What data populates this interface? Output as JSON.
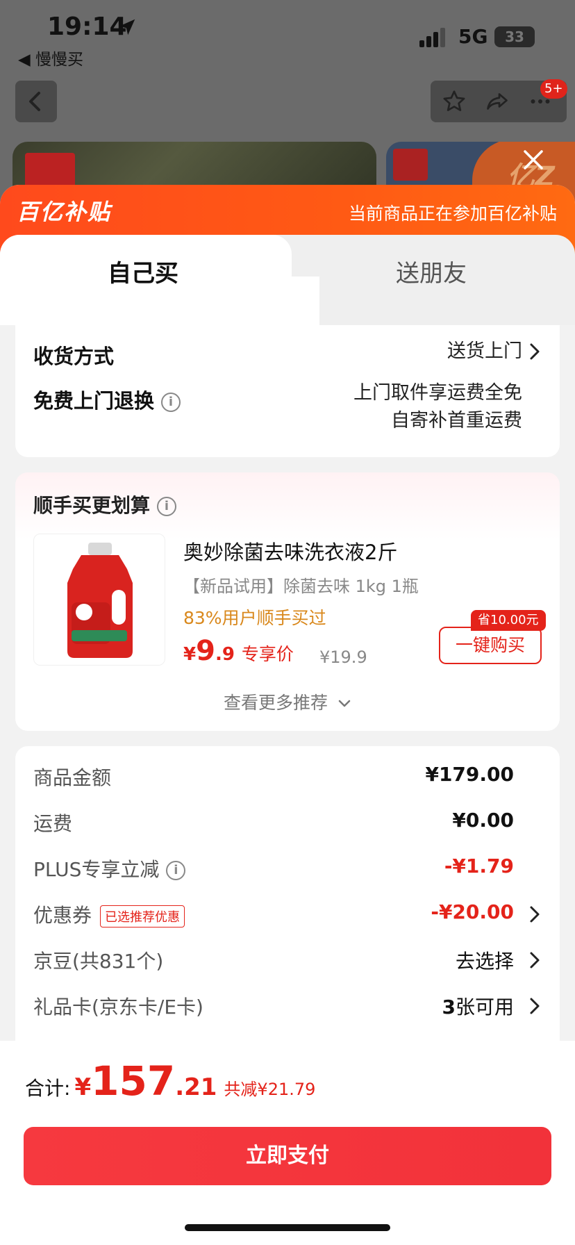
{
  "status_bar": {
    "time": "19:14",
    "back_app": "◀ 慢慢买",
    "network": "5G",
    "battery": "33"
  },
  "nav": {
    "badge": "5+"
  },
  "sheet": {
    "brand": "百亿补贴",
    "notice": "当前商品正在参加百亿补贴",
    "tabs": [
      {
        "label": "自己买",
        "active": true
      },
      {
        "label": "送朋友",
        "active": false
      }
    ]
  },
  "delivery": {
    "method_label": "收货方式",
    "method_value": "送货上门",
    "return_label": "免费上门退换",
    "return_value_1": "上门取件享运费全免",
    "return_value_2": "自寄补首重运费"
  },
  "recommend": {
    "title": "顺手买更划算",
    "product": {
      "name": "奥妙除菌去味洗衣液2斤",
      "subtitle": "【新品试用】除菌去味 1kg 1瓶",
      "bought": "83%用户顺手买过",
      "price_symbol": "¥",
      "price_int": "9",
      "price_dec": ".9",
      "price_tag": "专享价",
      "original_price": "¥19.9",
      "save_badge": "省10.00元",
      "buy_label": "一键购买"
    },
    "more": "查看更多推荐"
  },
  "summary": {
    "rows": [
      {
        "label": "商品金额",
        "value": "¥179.00"
      },
      {
        "label": "运费",
        "value": "¥0.00"
      },
      {
        "label": "PLUS专享立减",
        "value": "-¥1.79"
      },
      {
        "label": "优惠券",
        "tag": "已选推荐优惠",
        "value": "-¥20.00"
      },
      {
        "label": "京豆(共831个)",
        "value": "去选择"
      },
      {
        "label": "礼品卡(京东卡/E卡)",
        "value_num": "3",
        "value": "张可用"
      }
    ]
  },
  "checkout": {
    "total_label": "合计:",
    "total_symbol": "¥",
    "total_int": "157",
    "total_dec": ".21",
    "total_saved": "共减¥21.79",
    "pay_label": "立即支付"
  },
  "colors": {
    "accent_red": "#e4231a",
    "subsidy_orange": "#ff5014",
    "bought_orange": "#d9881c"
  }
}
